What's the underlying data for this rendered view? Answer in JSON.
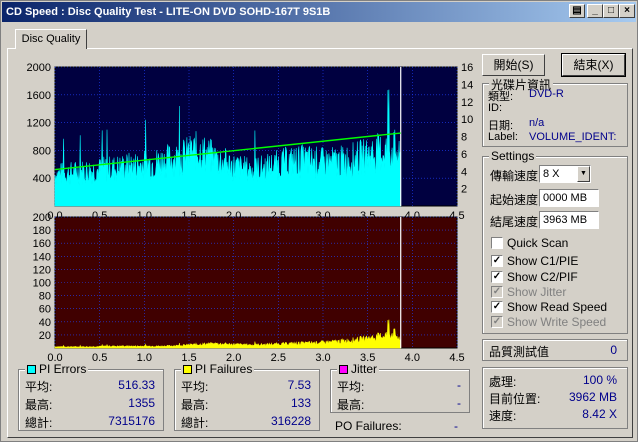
{
  "window": {
    "title": "CD Speed : Disc Quality Test - LITE-ON DVD SOHD-167T    9S1B"
  },
  "tab": {
    "label": "Disc Quality"
  },
  "buttons": {
    "start": "開始(S)",
    "end": "結束(X)"
  },
  "disc_info": {
    "title": "光碟片資訊",
    "type_label": "類型:",
    "type_value": "DVD-R",
    "id_label": "ID:",
    "id_value": "",
    "date_label": "日期:",
    "date_value": "n/a",
    "label_label": "Label:",
    "label_value": "VOLUME_IDENT:"
  },
  "settings": {
    "title": "Settings",
    "speed_label": "傳輸速度",
    "speed_value": "8 X",
    "start_label": "起始速度",
    "start_value": "0000 MB",
    "end_label": "結尾速度",
    "end_value": "3963 MB",
    "quick_scan": "Quick Scan",
    "show_c1": "Show C1/PIE",
    "show_c2": "Show C2/PIF",
    "show_jitter": "Show Jitter",
    "show_read": "Show Read Speed",
    "show_write": "Show Write Speed"
  },
  "quality": {
    "label": "品質測試值",
    "value": "0"
  },
  "progress": {
    "proc_label": "處理:",
    "proc_value": "100 %",
    "pos_label": "目前位置:",
    "pos_value": "3962 MB",
    "speed_label": "速度:",
    "speed_value": "8.42 X"
  },
  "pi_errors": {
    "title": "PI Errors",
    "avg_label": "平均:",
    "avg": "516.33",
    "max_label": "最高:",
    "max": "1355",
    "total_label": "總計:",
    "total": "7315176"
  },
  "pi_failures": {
    "title": "PI Failures",
    "avg_label": "平均:",
    "avg": "7.53",
    "max_label": "最高:",
    "max": "133",
    "total_label": "總計:",
    "total": "316228"
  },
  "jitter": {
    "title": "Jitter",
    "avg_label": "平均:",
    "avg": "-",
    "max_label": "最高:",
    "max": "-"
  },
  "po_failures": {
    "label": "PO Failures:",
    "value": "-"
  },
  "colors": {
    "pie": "#00ffff",
    "pif": "#ffff00",
    "speed": "#00ff00",
    "top_bg": "#000040",
    "bottom_bg": "#400000",
    "jitter": "#ff00ff"
  },
  "chart_data": [
    {
      "type": "area",
      "title": "PI Errors",
      "x_ticks": [
        "0.0",
        "0.5",
        "1.0",
        "1.5",
        "2.0",
        "2.5",
        "3.0",
        "3.5",
        "4.0",
        "4.5"
      ],
      "y_left_ticks": [
        "2000",
        "1600",
        "1200",
        "800",
        "400"
      ],
      "y_right_ticks": [
        "16",
        "14",
        "12",
        "10",
        "8",
        "6",
        "4",
        "2"
      ],
      "xlim": [
        0,
        4.5
      ],
      "ylim": [
        0,
        2000
      ],
      "y2lim": [
        0,
        16
      ],
      "x": [
        0,
        0.2,
        0.4,
        0.6,
        0.8,
        1.0,
        1.2,
        1.4,
        1.6,
        1.8,
        2.0,
        2.2,
        2.4,
        2.6,
        2.8,
        3.0,
        3.2,
        3.4,
        3.6,
        3.8,
        3.87
      ],
      "values": [
        500,
        520,
        560,
        580,
        620,
        650,
        700,
        760,
        880,
        740,
        620,
        560,
        620,
        690,
        720,
        680,
        700,
        760,
        840,
        900,
        700
      ],
      "speed_x": [
        0,
        3.87
      ],
      "speed_y": [
        4.2,
        8.4
      ],
      "end_marker": 3.87
    },
    {
      "type": "area",
      "title": "PI Failures",
      "x_ticks": [
        "0.0",
        "0.5",
        "1.0",
        "1.5",
        "2.0",
        "2.5",
        "3.0",
        "3.5",
        "4.0",
        "4.5"
      ],
      "y_ticks": [
        "200",
        "180",
        "160",
        "140",
        "120",
        "100",
        "80",
        "60",
        "40",
        "20"
      ],
      "xlim": [
        0,
        4.5
      ],
      "ylim": [
        0,
        200
      ],
      "x": [
        0,
        0.2,
        0.4,
        0.6,
        0.8,
        1.0,
        1.2,
        1.4,
        1.6,
        1.8,
        2.0,
        2.2,
        2.4,
        2.6,
        2.8,
        3.0,
        3.2,
        3.4,
        3.6,
        3.8,
        3.87
      ],
      "values": [
        2,
        2,
        2,
        3,
        3,
        3,
        3,
        4,
        6,
        7,
        6,
        5,
        6,
        7,
        8,
        9,
        11,
        14,
        18,
        25,
        10
      ],
      "end_marker": 3.87
    }
  ]
}
